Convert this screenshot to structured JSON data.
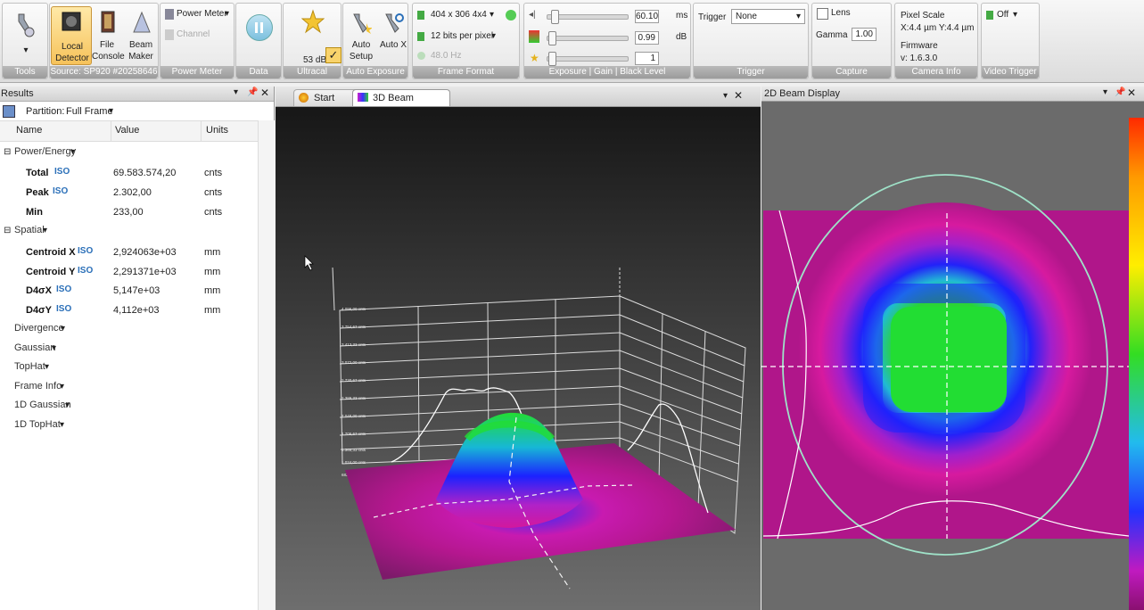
{
  "ribbon": {
    "tools_caption": "Tools",
    "source": {
      "local_detector": "Local Detector",
      "file_console": "File Console",
      "beam_maker": "Beam Maker",
      "caption": "Source: SP920 #20258646"
    },
    "power_meter": {
      "label": "Power Meter",
      "channel": "Channel",
      "caption": "Power Meter"
    },
    "data_caption": "Data",
    "ultracal": {
      "value": "53 dB",
      "caption": "Ultracal"
    },
    "auto_exposure": {
      "auto_setup": "Auto Setup",
      "auto_x": "Auto X",
      "caption": "Auto Exposure"
    },
    "frame_format": {
      "resolution": "404 x 306 4x4",
      "bits": "12 bits per pixel",
      "rate": "48.0 Hz",
      "caption": "Frame Format"
    },
    "exposure": {
      "exposure_value": "60.10",
      "exposure_unit": "ms",
      "gain_value": "0.99",
      "gain_unit": "dB",
      "black_value": "1",
      "caption": "Exposure | Gain | Black Level"
    },
    "trigger": {
      "label": "Trigger",
      "value": "None",
      "caption": "Trigger"
    },
    "capture": {
      "lens": "Lens",
      "gamma_label": "Gamma",
      "gamma_value": "1.00",
      "caption": "Capture"
    },
    "camera_info": {
      "pixel_scale": "Pixel Scale",
      "scale_values": "X:4.4 µm  Y:4.4 µm",
      "firmware": "Firmware",
      "firmware_version": "v: 1.6.3.0",
      "caption": "Camera Info"
    },
    "video_trigger": {
      "value": "Off",
      "caption": "Video Trigger"
    }
  },
  "results": {
    "title": "Results",
    "partition_label": "Partition:",
    "partition_value": "Full Frame",
    "columns": [
      "Name",
      "Value",
      "Units"
    ],
    "power_energy": "Power/Energy",
    "rows_power": [
      {
        "name": "Total",
        "iso": "ISO",
        "value": "69.583.574,20",
        "unit": "cnts"
      },
      {
        "name": "Peak",
        "iso": "ISO",
        "value": "2.302,00",
        "unit": "cnts"
      },
      {
        "name": "Min",
        "iso": "",
        "value": "233,00",
        "unit": "cnts"
      }
    ],
    "spatial": "Spatial",
    "rows_spatial": [
      {
        "name": "Centroid X",
        "iso": "ISO",
        "value": "2,924063e+03",
        "unit": "mm"
      },
      {
        "name": "Centroid Y",
        "iso": "ISO",
        "value": "2,291371e+03",
        "unit": "mm"
      },
      {
        "name": "D4σX",
        "iso": "ISO",
        "value": "5,147e+03",
        "unit": "mm"
      },
      {
        "name": "D4σY",
        "iso": "ISO",
        "value": "4,112e+03",
        "unit": "mm"
      }
    ],
    "categories": [
      "Divergence",
      "Gaussian",
      "TopHat",
      "Frame Info",
      "1D Gaussian",
      "1D TopHat"
    ]
  },
  "tabs": {
    "start_page": "Start Page",
    "beam_3d": "3D Beam Display"
  },
  "beam2d": {
    "title": "2D Beam Display"
  },
  "axis3d": {
    "ticks": [
      "4.096,00 cnts",
      "3.754,67 cnts",
      "3.413,33 cnts",
      "3.072,00 cnts",
      "2.730,67 cnts",
      "2.389,33 cnts",
      "2.048,00 cnts",
      "1.706,67 cnts",
      "1.365,33 cnts",
      "1.024,00 cnts",
      "682,67 cnts"
    ]
  },
  "colors": {
    "accent_iso": "#2a6fb8",
    "magenta": "#b5178f",
    "green": "#22dd33",
    "blue": "#1b22ff"
  }
}
